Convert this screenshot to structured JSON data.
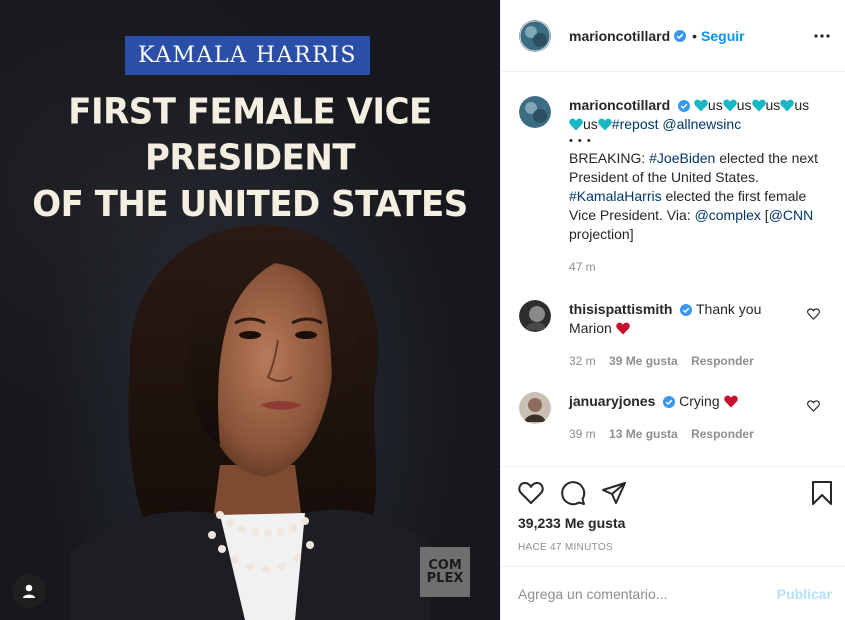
{
  "post_image": {
    "badge": "KAMALA HARRIS",
    "headline_line1": "FIRST FEMALE VICE PRESIDENT",
    "headline_line2": "OF THE UNITED STATES",
    "logo_line1": "COM",
    "logo_line2": "PLEX"
  },
  "header": {
    "username": "marioncotillard",
    "separator": "•",
    "follow_label": "Seguir",
    "more_icon": "more-horizontal-icon"
  },
  "caption": {
    "username": "marioncotillard",
    "hearts_line": "us",
    "repost_tag": "#repost",
    "source_mention": "@allnewsinc",
    "dots": "• • •",
    "text_1": "BREAKING: ",
    "tag_joebiden": "#JoeBiden",
    "text_2": " elected the next President of the United States. ",
    "tag_kamala": "#KamalaHarris",
    "text_3": " elected the first female Vice President. Via: ",
    "mention_complex": "@complex",
    "text_4": " [",
    "mention_cnn": "@CNN",
    "text_5": " projection]",
    "time": "47 m",
    "heart_color": "#17b7c3"
  },
  "comments": [
    {
      "username": "thisispattismith",
      "text": "Thank you Marion",
      "time": "32 m",
      "likes": "39 Me gusta",
      "reply": "Responder"
    },
    {
      "username": "januaryjones",
      "text": "Crying",
      "time": "39 m",
      "likes": "13 Me gusta",
      "reply": "Responder"
    }
  ],
  "actions": {
    "likes": "39,233 Me gusta",
    "time_ago": "HACE 47 MINUTOS"
  },
  "add_comment": {
    "placeholder": "Agrega un comentario...",
    "publish_label": "Publicar"
  },
  "colors": {
    "accent": "#0095f6",
    "link": "#00376b",
    "red_heart": "#c8102e",
    "badge_blue": "#2b4fa8"
  }
}
